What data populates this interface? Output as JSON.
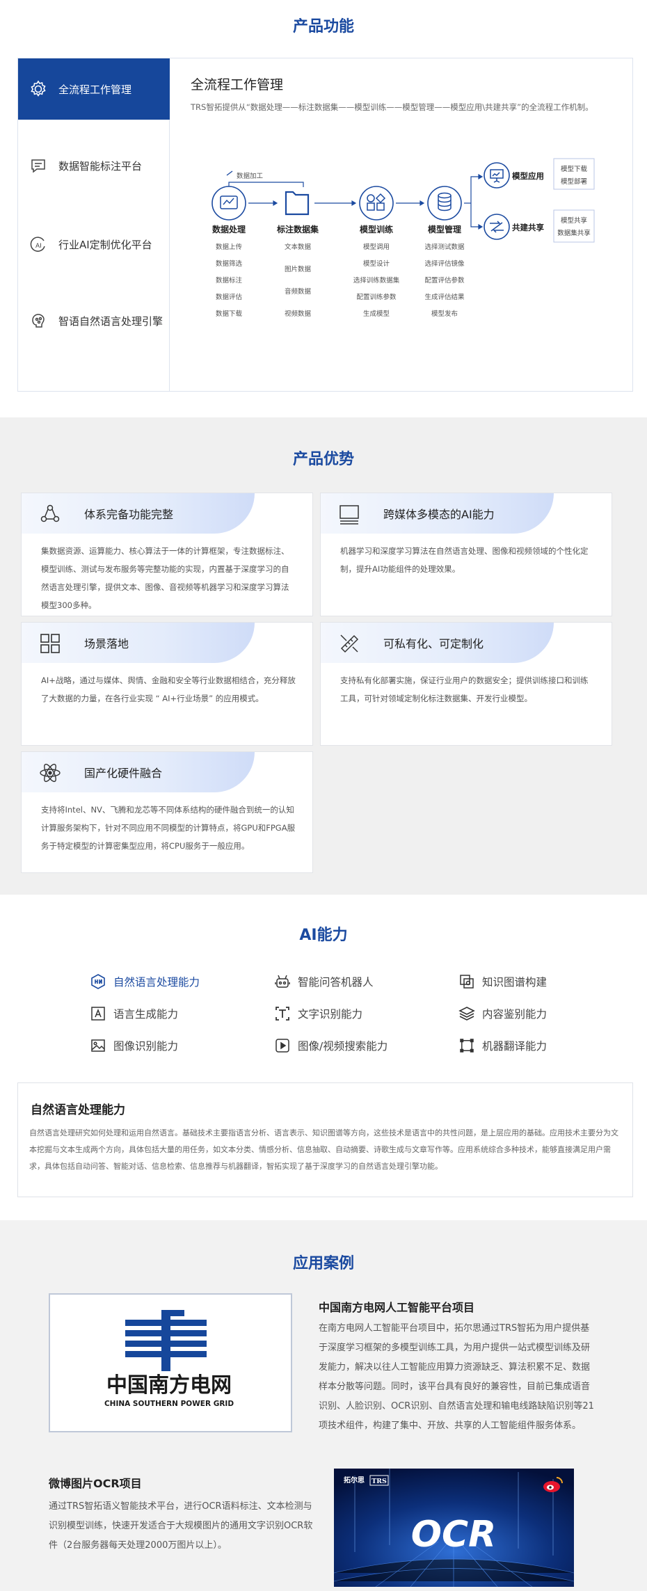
{
  "func": {
    "title": "产品功能",
    "tabs": [
      {
        "label": "全流程工作管理",
        "icon": "gear-icon"
      },
      {
        "label": "数据智能标注平台",
        "icon": "chat-icon"
      },
      {
        "label": "行业AI定制优化平台",
        "icon": "ai-icon"
      },
      {
        "label": "智语自然语言处理引擎",
        "icon": "brain-icon"
      }
    ],
    "content_title": "全流程工作管理",
    "content_desc": "TRS智拓提供从“数据处理——标注数据集——模型训练——模型管理——模型应用\\共建共享”的全流程工作机制。",
    "flow": {
      "processing_label": "数据加工",
      "stages": [
        {
          "title": "数据处理",
          "items": [
            "数据上传",
            "数据筛选",
            "数据标注",
            "数据评估",
            "数据下载"
          ]
        },
        {
          "title": "标注数据集",
          "items": [
            "文本数据",
            "图片数据",
            "音频数据",
            "视频数据"
          ]
        },
        {
          "title": "模型训练",
          "items": [
            "模型调用",
            "模型设计",
            "选择训练数据集",
            "配置训练参数",
            "生成模型"
          ]
        },
        {
          "title": "模型管理",
          "items": [
            "选择测试数据",
            "选择评估镜像",
            "配置评估参数",
            "生成评估结果",
            "模型发布"
          ]
        }
      ],
      "branches": [
        {
          "title": "模型应用",
          "items": [
            "模型下载",
            "模型部署"
          ]
        },
        {
          "title": "共建共享",
          "items": [
            "模型共享",
            "数据集共享"
          ]
        }
      ]
    }
  },
  "adv": {
    "title": "产品优势",
    "cards": [
      {
        "title": "体系完备功能完整",
        "icon": "network-icon",
        "desc": "集数据资源、运算能力、核心算法于一体的计算框架，专注数据标注、模型训练、测试与发布服务等完整功能的实现，内置基于深度学习的自然语言处理引擎，提供文本、图像、音视频等机器学习和深度学习算法模型300多种。"
      },
      {
        "title": "跨媒体多模态的AI能力",
        "icon": "monitor-icon",
        "desc": "机器学习和深度学习算法在自然语言处理、图像和视频领域的个性化定制，提升AI功能组件的处理效果。"
      },
      {
        "title": "场景落地",
        "icon": "grid-icon",
        "desc": "AI+战略，通过与媒体、舆情、金融和安全等行业数据相结合，充分释放了大数据的力量，在各行业实现 “ AI+行业场景” 的应用模式。"
      },
      {
        "title": "可私有化、可定制化",
        "icon": "ruler-icon",
        "desc": "支持私有化部署实施，保证行业用户的数据安全；提供训练接口和训练工具，可针对领域定制化标注数据集、开发行业模型。"
      },
      {
        "title": "国产化硬件融合",
        "icon": "atom-icon",
        "desc": "支持将Intel、NV、飞腾和龙芯等不同体系结构的硬件融合到统一的认知计算服务架构下，针对不同应用不同模型的计算特点，将GPU和FPGA服务于特定模型的计算密集型应用，将CPU服务于一般应用。"
      }
    ]
  },
  "ai": {
    "title": "AI能力",
    "items": [
      {
        "label": "自然语言处理能力",
        "icon": "nlp-icon"
      },
      {
        "label": "智能问答机器人",
        "icon": "robot-icon"
      },
      {
        "label": "知识图谱构建",
        "icon": "knowledge-graph-icon"
      },
      {
        "label": "语言生成能力",
        "icon": "text-generate-icon"
      },
      {
        "label": "文字识别能力",
        "icon": "text-recognize-icon"
      },
      {
        "label": "内容鉴别能力",
        "icon": "layers-icon"
      },
      {
        "label": "图像识别能力",
        "icon": "image-icon"
      },
      {
        "label": "图像/视频搜索能力",
        "icon": "video-icon"
      },
      {
        "label": "机器翻译能力",
        "icon": "translate-icon"
      }
    ],
    "detail_title": "自然语言处理能力",
    "detail_desc": "自然语言处理研究如何处理和运用自然语言。基础技术主要指语言分析、语言表示、知识图谱等方向，这些技术是语言中的共性问题，是上层应用的基础。应用技术主要分为文本挖掘与文本生成两个方向，具体包括大量的用任务，如文本分类、情感分析、信息抽取、自动摘要、诗歌生成与文章写作等。应用系统综合多种技术，能够直接满足用户需求，具体包括自动问答、智能对话、信息检索、信息推荐与机器翻译，智拓实现了基于深度学习的自然语言处理引擎功能。"
  },
  "cases": {
    "title": "应用案例",
    "case1_title": "中国南方电网人工智能平台项目",
    "case1_desc": "在南方电网人工智能平台项目中，拓尔思通过TRS智拓为用户提供基于深度学习框架的多模型训练工具，为用户提供一站式模型训练及研发能力，解决以往人工智能应用算力资源缺乏、算法积累不足、数据样本分散等问题。同时，该平台具有良好的兼容性，目前已集成语音识别、人脸识别、OCR识别、自然语言处理和输电线路缺陷识别等21项技术组件，构建了集中、开放、共享的人工智能组件服务体系。",
    "logo_cn": "中国南方电网",
    "logo_en": "CHINA SOUTHERN POWER GRID",
    "case2_title": "微博图片OCR项目",
    "case2_desc": "通过TRS智拓语义智能技术平台，进行OCR语料标注、文本检测与识别模型训练，快速开发适合于大规模图片的通用文字识别OCR软件（2台服务器每天处理2000万图片以上）。",
    "ocr_text": "OCR",
    "ocr_brand": "TRS",
    "ocr_brand_cn": "拓尔思"
  },
  "colors": {
    "primary": "#1b4aa0",
    "active_tab": "#16479b",
    "gray_bg": "#f0f0f0"
  }
}
